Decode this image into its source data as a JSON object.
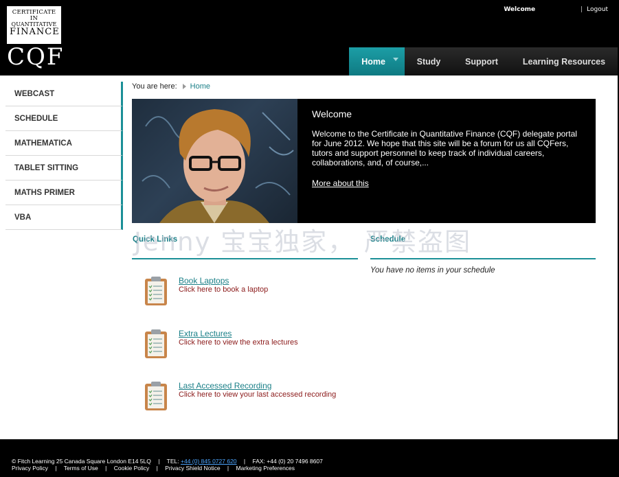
{
  "header": {
    "logo": {
      "line1": "CERTIFICATE IN",
      "line2": "QUANTITATIVE",
      "line3": "FINANCE",
      "mark": "CQF"
    },
    "welcome_label": "Welcome",
    "logout_label": "Logout"
  },
  "nav": {
    "items": [
      {
        "label": "Home",
        "active": true
      },
      {
        "label": "Study"
      },
      {
        "label": "Support"
      },
      {
        "label": "Learning Resources"
      }
    ]
  },
  "sidebar": {
    "items": [
      {
        "label": "WEBCAST"
      },
      {
        "label": "SCHEDULE"
      },
      {
        "label": "MATHEMATICA"
      },
      {
        "label": "TABLET SITTING"
      },
      {
        "label": "MATHS PRIMER"
      },
      {
        "label": "VBA"
      }
    ]
  },
  "breadcrumb": {
    "label": "You are here:",
    "current": "Home"
  },
  "hero": {
    "title": "Welcome",
    "body": "Welcome to the Certificate in Quantitative Finance (CQF) delegate portal for June 2012. We hope that this site will be a forum for us all CQFers, tutors and support personnel to keep track of individual careers, collaborations, and, of course,...",
    "more_link": "More about this"
  },
  "quick_links": {
    "heading": "Quick Links",
    "items": [
      {
        "title": "Book Laptops",
        "desc": "Click here to book a laptop",
        "icon": "clipboard-icon"
      },
      {
        "title": "Extra Lectures",
        "desc": "Click here to view the extra lectures",
        "icon": "clipboard-icon"
      },
      {
        "title": "Last Accessed Recording",
        "desc": "Click here to view your last accessed recording",
        "icon": "clipboard-icon"
      }
    ]
  },
  "schedule": {
    "heading": "Schedule",
    "empty_text": "You have no items in your schedule"
  },
  "watermark": "Jenny 宝宝独家， 严禁盗图",
  "footer": {
    "address": "© Fitch Learning 25 Canada Square London E14 5LQ",
    "tel_label": "TEL:",
    "tel": "+44 (0) 845 0727 620",
    "fax": "FAX: +44 (0) 20 7496 8607",
    "links": [
      "Privacy Policy",
      "Terms of Use",
      "Cookie Policy",
      "Privacy Shield Notice",
      "Marketing Preferences"
    ]
  },
  "colors": {
    "accent": "#1a8f97",
    "link": "#1a7f87",
    "desc_text": "#8b1a1a",
    "header_bg": "#000000"
  }
}
